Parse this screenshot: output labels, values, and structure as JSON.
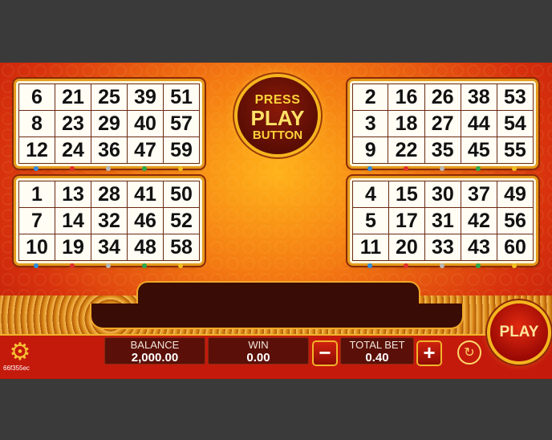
{
  "cards": [
    {
      "rows": [
        [
          6,
          21,
          25,
          39,
          51
        ],
        [
          8,
          23,
          29,
          40,
          57
        ],
        [
          12,
          24,
          36,
          47,
          59
        ]
      ]
    },
    {
      "rows": [
        [
          2,
          16,
          26,
          38,
          53
        ],
        [
          3,
          18,
          27,
          44,
          54
        ],
        [
          9,
          22,
          35,
          45,
          55
        ]
      ]
    },
    {
      "rows": [
        [
          1,
          13,
          28,
          41,
          50
        ],
        [
          7,
          14,
          32,
          46,
          52
        ],
        [
          10,
          19,
          34,
          48,
          58
        ]
      ]
    },
    {
      "rows": [
        [
          4,
          15,
          30,
          37,
          49
        ],
        [
          5,
          17,
          31,
          42,
          56
        ],
        [
          11,
          20,
          33,
          43,
          60
        ]
      ]
    }
  ],
  "dot_colors": [
    "#2b8de0",
    "#e0302a",
    "#b8b8b8",
    "#2aa84a",
    "#f0c020"
  ],
  "center_button": {
    "line1": "PRESS",
    "line2": "PLAY",
    "line3": "BUTTON"
  },
  "balance": {
    "label": "BALANCE",
    "value": "2,000.00"
  },
  "win": {
    "label": "WIN",
    "value": "0.00"
  },
  "total_bet": {
    "label": "TOTAL BET",
    "value": "0.40"
  },
  "buttons": {
    "minus": "−",
    "plus": "+",
    "play": "PLAY",
    "auto": "↻"
  },
  "icons": {
    "settings": "⚙"
  },
  "version": "66f355ec"
}
